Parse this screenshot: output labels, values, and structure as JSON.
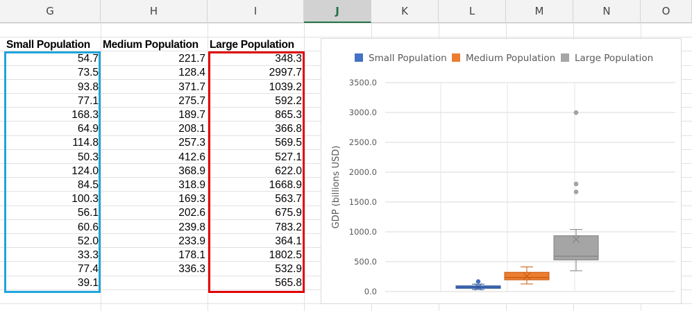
{
  "columns": [
    {
      "letter": "G",
      "active": false
    },
    {
      "letter": "H",
      "active": false
    },
    {
      "letter": "I",
      "active": false
    },
    {
      "letter": "J",
      "active": true
    },
    {
      "letter": "K",
      "active": false
    },
    {
      "letter": "L",
      "active": false
    },
    {
      "letter": "M",
      "active": false
    },
    {
      "letter": "N",
      "active": false
    },
    {
      "letter": "O",
      "active": false
    }
  ],
  "table": {
    "headers": [
      "Small Population",
      "Medium Population",
      "Large Population"
    ],
    "small": [
      "54.7",
      "73.5",
      "93.8",
      "77.1",
      "168.3",
      "64.9",
      "114.8",
      "50.3",
      "124.0",
      "84.5",
      "100.3",
      "56.1",
      "60.6",
      "52.0",
      "33.3",
      "77.4",
      "39.1"
    ],
    "medium": [
      "221.7",
      "128.4",
      "371.7",
      "275.7",
      "189.7",
      "208.1",
      "257.3",
      "412.6",
      "368.9",
      "318.9",
      "169.3",
      "202.6",
      "239.8",
      "233.9",
      "178.1",
      "336.3"
    ],
    "large": [
      "348.3",
      "2997.7",
      "1039.2",
      "592.2",
      "865.3",
      "366.8",
      "569.5",
      "527.1",
      "622.0",
      "1668.9",
      "563.7",
      "675.9",
      "783.2",
      "364.1",
      "1802.5",
      "532.9",
      "565.8"
    ]
  },
  "chart_data": {
    "type": "box",
    "ylabel": "GDP (billions USD)",
    "ylim": [
      0,
      3500
    ],
    "yticks": [
      "0.0",
      "500.0",
      "1000.0",
      "1500.0",
      "2000.0",
      "2500.0",
      "3000.0",
      "3500.0"
    ],
    "legend_position": "top",
    "series": [
      {
        "name": "Small Population",
        "color": "#4472c4",
        "whisker_low": 33.3,
        "q1": 54.0,
        "median": 73.5,
        "q3": 96.0,
        "whisker_high": 124.0,
        "mean": 77.9,
        "outliers": [
          168.3
        ]
      },
      {
        "name": "Medium Population",
        "color": "#ed7d31",
        "whisker_low": 128.4,
        "q1": 196.0,
        "median": 236.9,
        "q3": 323.0,
        "whisker_high": 412.6,
        "mean": 257.3,
        "outliers": []
      },
      {
        "name": "Large Population",
        "color": "#a5a5a5",
        "whisker_low": 348.3,
        "q1": 530.0,
        "median": 592.2,
        "q3": 935.0,
        "whisker_high": 1039.2,
        "mean": 875.0,
        "outliers": [
          1668.9,
          1802.5,
          2997.7
        ]
      }
    ]
  }
}
